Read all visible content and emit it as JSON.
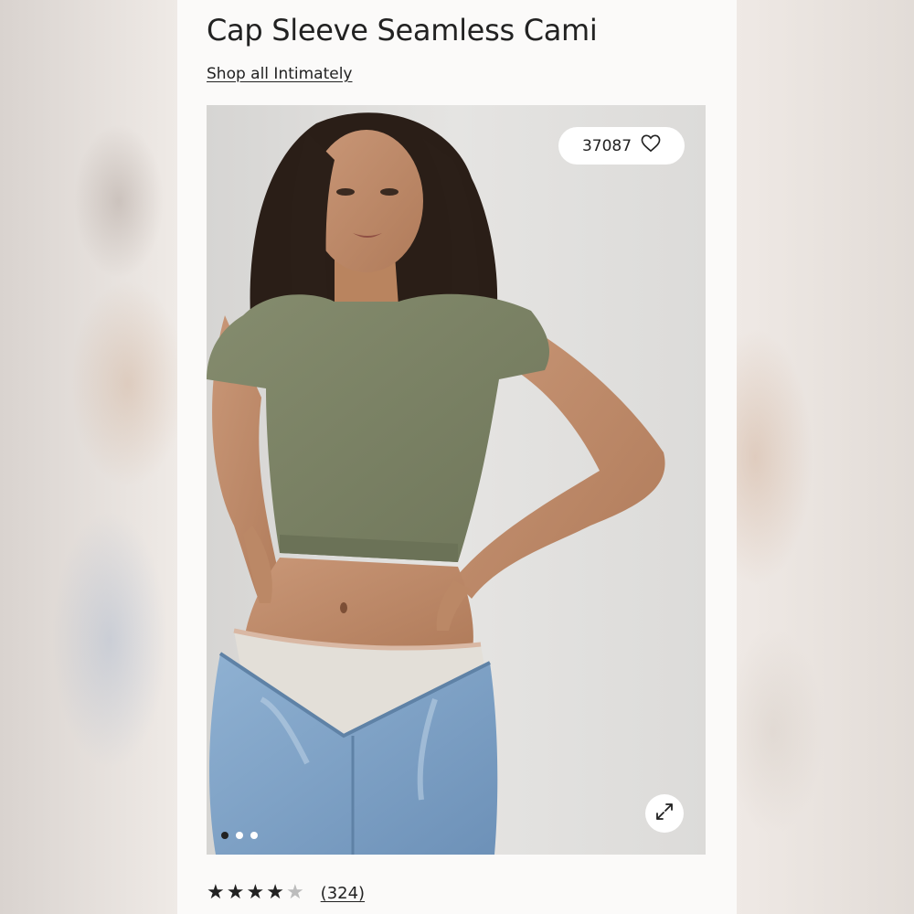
{
  "product": {
    "title": "Cap Sleeve Seamless Cami",
    "shop_link": "Shop all Intimately"
  },
  "gallery": {
    "favorites_count": "37087",
    "favorite_icon": "heart-icon",
    "expand_icon": "expand-icon",
    "slide_count": 3,
    "active_slide": 1,
    "image_alt": "Model wearing olive green cap sleeve seamless cami with light blue jeans"
  },
  "reviews": {
    "rating": 4,
    "max_rating": 5,
    "count_label": "(324)"
  },
  "colors": {
    "text": "#222222",
    "card_bg": "#fbfaf9",
    "photo_bg": "#e2e1df",
    "cami": "#7d8466",
    "jeans": "#7fa2c7",
    "star_off": "#bcbcbc"
  }
}
